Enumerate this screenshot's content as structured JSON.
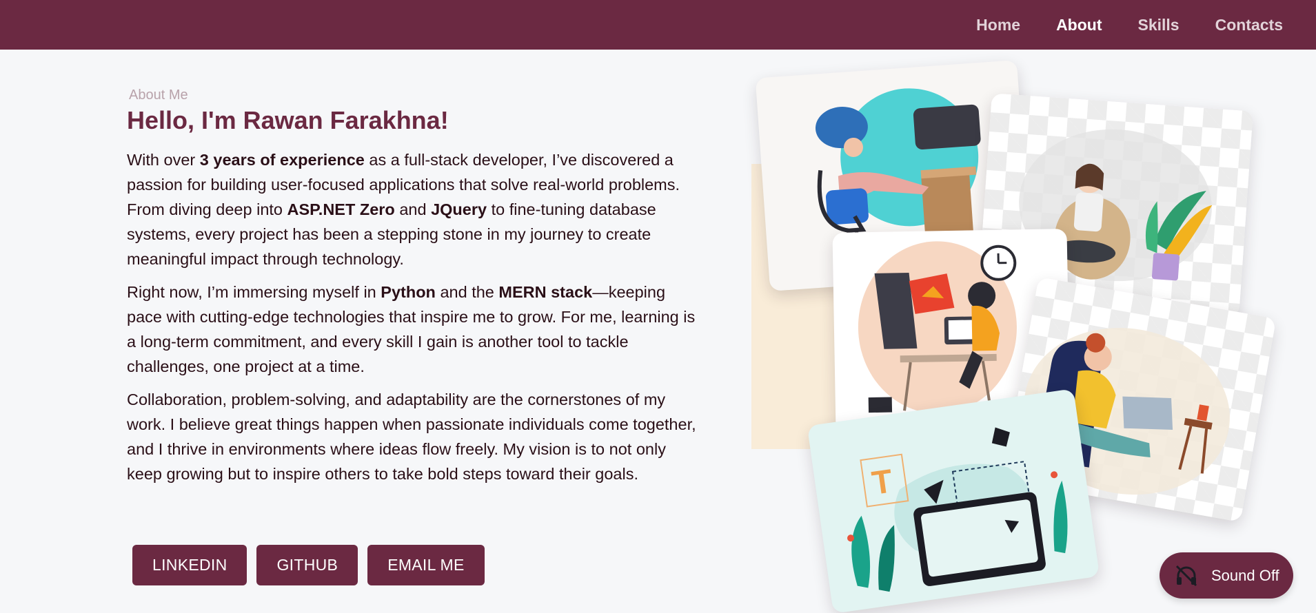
{
  "nav": {
    "items": [
      {
        "label": "Home",
        "active": false
      },
      {
        "label": "About",
        "active": true
      },
      {
        "label": "Skills",
        "active": false
      },
      {
        "label": "Contacts",
        "active": false
      }
    ]
  },
  "about": {
    "eyebrow": "About Me",
    "title": "Hello, I'm Rawan Farakhna!",
    "p1": {
      "t1": "With over ",
      "b1": "3 years of experience",
      "t2": " as a full-stack developer, I’ve discovered a passion for building user-focused applications that solve real-world problems. From diving deep into ",
      "b2": "ASP.NET Zero",
      "t3": " and ",
      "b3": "JQuery",
      "t4": " to fine-tuning database systems, every project has been a stepping stone in my journey to create meaningful impact through technology."
    },
    "p2": {
      "t1": "Right now, I’m immersing myself in ",
      "b1": "Python",
      "t2": " and the ",
      "b2": "MERN stack",
      "t3": "—keeping pace with cutting-edge technologies that inspire me to grow. For me, learning is a long-term commitment, and every skill I gain is another tool to tackle challenges, one project at a time."
    },
    "p3": "Collaboration, problem-solving, and adaptability are the cornerstones of my work. I believe great things happen when passionate individuals come together, and I thrive in environments where ideas flow freely. My vision is to not only keep growing but to inspire others to take bold steps toward their goals."
  },
  "buttons": {
    "linkedin": "LINKEDIN",
    "github": "GITHUB",
    "email": "EMAIL ME"
  },
  "sound": {
    "label": "Sound Off",
    "icon": "headphones-muted-icon"
  },
  "colors": {
    "brand": "#6b2942",
    "background": "#f6f7f9",
    "text": "#2a0f17"
  }
}
